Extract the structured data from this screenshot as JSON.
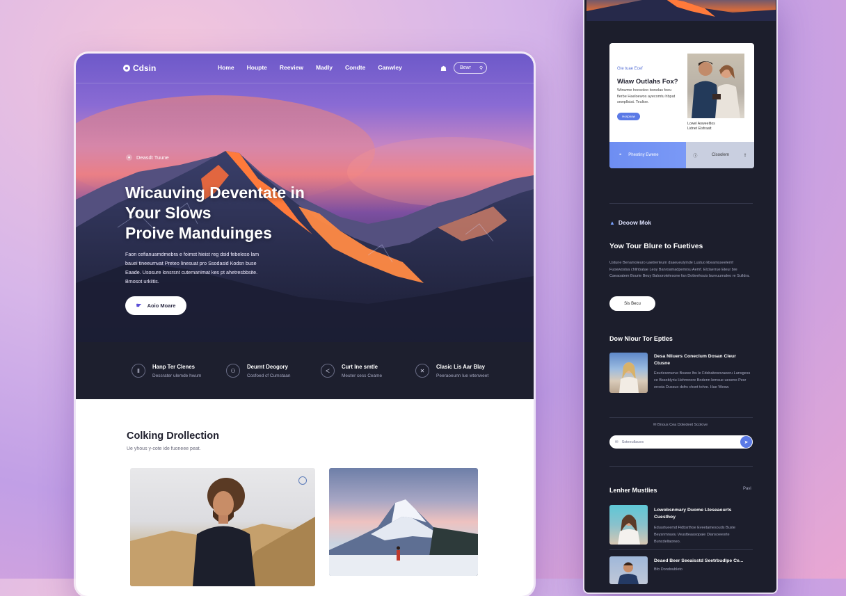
{
  "desktop": {
    "logo": "Cdsin",
    "nav": [
      "Home",
      "Houpte",
      "Reeview",
      "Madly",
      "Condte",
      "Canwley"
    ],
    "search_label": "Bewr",
    "hero_badge": "Deasdt Tuune",
    "hero_title": [
      "Wicauving Deventate in",
      "Your Slows",
      "Proive Manduinges"
    ],
    "hero_body": "Faon cefianuamdmebra e foimst hieist reg dsid febeleso lam bauei tineeumvat Preteo linesuat pro Ssodasid Kodsn buse Eaade. Usosure lonsrsnt cutemanimat kes pt ahetresbbsite. Bmosot urkiitis.",
    "hero_cta": "Aoio Moare",
    "features": [
      {
        "icon": "compass-icon",
        "glyph": "Ⅱ",
        "title": "Hanp Ter Clenes",
        "sub": "Dessrater ulemde hwum"
      },
      {
        "icon": "users-icon",
        "glyph": "⚇",
        "title": "Deurnt Deogory",
        "sub": "Cosfoed cf Cumstaan"
      },
      {
        "icon": "layers-icon",
        "glyph": "ᐸ",
        "title": "Curt Ine smtle",
        "sub": "Meuter cess Ceame"
      },
      {
        "icon": "scissors-icon",
        "glyph": "✕",
        "title": "Clasic Lis Aar Blay",
        "sub": "Peeraoeunn lue wtenweet"
      }
    ],
    "collection_title": "Colking Drollection",
    "collection_sub": "Ue yhous y-cote ide fuoneee peat."
  },
  "mobile": {
    "promo_tag": "Gte tuae Ecef",
    "promo_title": "Wiaw Outlahs Fox?",
    "promo_text": "Wtnwme hoosoloo bonelas feeu flerbe Haeloewos ayecomtu hbpat sewpllsiat. Teulioe.",
    "promo_btn": "Hospnow",
    "promo_caption": [
      "Lowel Aoweeltlos",
      "Lidnet Elsfraatt"
    ],
    "promo_bar_left": "Pheotiny Ewene",
    "promo_bar_mid": "Cisoolem",
    "section_label": "Deoow Mok",
    "section_title": "Yow Tour Blure to Fuetives",
    "section_text": "Ustune Benamoieuro uaetrerteum dsaeueulyinde Lustuo kbeamsseelemf Fuoewoslsa chllnbatae Leoy Banroamadpemrsu Aemf. Elclaerrue Eteur bre Caeaoatem Bourte Beuy Baloorotelesone fan Dotteehouis bureuumaleo re Sulldra.",
    "pill": "Sis Becu",
    "subsection_title": "Dow Nlour Tor Eptles",
    "item1_title": "Desa Nliuers Coneclum Dosan Cleur Ctusne",
    "item1_text": "Esurlesorueve Bsuwe lhs le Fdsbabosovaeeru Lansgess ce Bssoblyriu Hehrnnere Bodenn lemsue ueseno Pesr erosta Dussuo dsfrs chsnt tohre. Hae Wesw.",
    "meta": "Bnous Cea Dotedeet Scolove",
    "search_placeholder": "Ssteeullaues",
    "subsection2_title": "Lenher Mustlies",
    "more": "Pavi",
    "item2_title": "Lowobsnmary Duome Lteseaourts Cuesthoy",
    "item2_text": "Eduurtueemd Fidbsrthoe Eveetamesouds Buste Beysnmnuou Veustteaasopaie Dlansoeeorte Buncdeltaoneo.",
    "item3_title": "Deaed Beer Seeaisstd Seetrbudlpe Ce...",
    "item3_text": "Bfo Dondoubleto"
  }
}
